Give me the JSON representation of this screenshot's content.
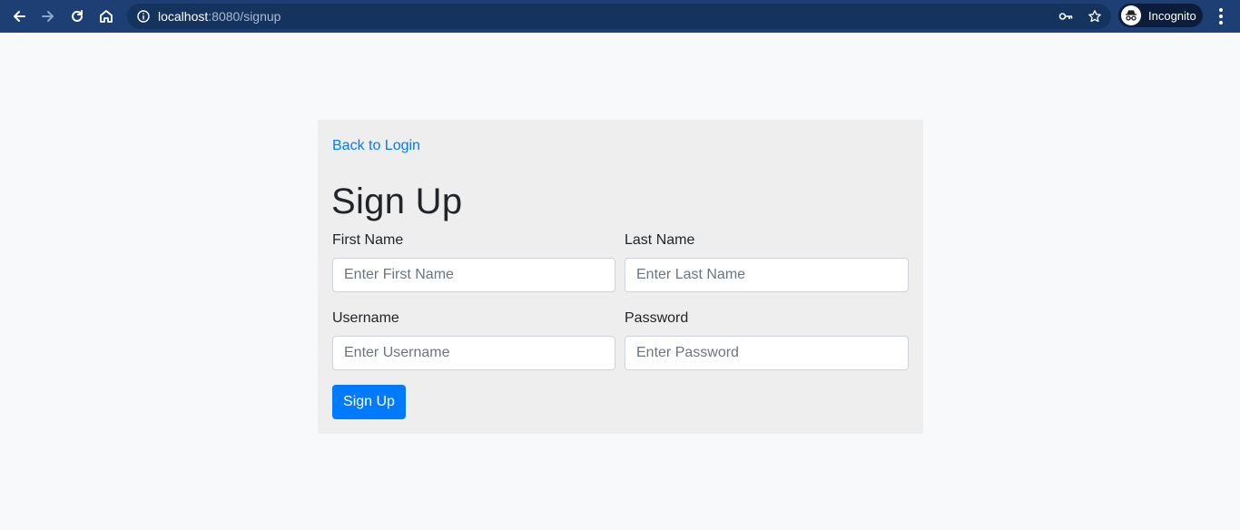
{
  "browser": {
    "url_host": "localhost",
    "url_path": ":8080/signup",
    "profile_label": "Incognito",
    "icons": [
      "back-arrow-icon",
      "forward-arrow-icon",
      "reload-icon",
      "home-icon",
      "info-icon",
      "key-icon",
      "star-icon",
      "incognito-icon",
      "more-vertical-icon"
    ]
  },
  "page": {
    "back_link": "Back to Login",
    "title": "Sign Up",
    "fields": {
      "first_name": {
        "label": "First Name",
        "placeholder": "Enter First Name",
        "value": ""
      },
      "last_name": {
        "label": "Last Name",
        "placeholder": "Enter Last Name",
        "value": ""
      },
      "username": {
        "label": "Username",
        "placeholder": "Enter Username",
        "value": ""
      },
      "password": {
        "label": "Password",
        "placeholder": "Enter Password",
        "value": ""
      }
    },
    "submit_label": "Sign Up"
  },
  "colors": {
    "chrome_bg": "#1d3f73",
    "page_bg": "#f8f9fa",
    "card_bg": "#eeeeee",
    "primary": "#007bff",
    "link": "#007bff"
  }
}
